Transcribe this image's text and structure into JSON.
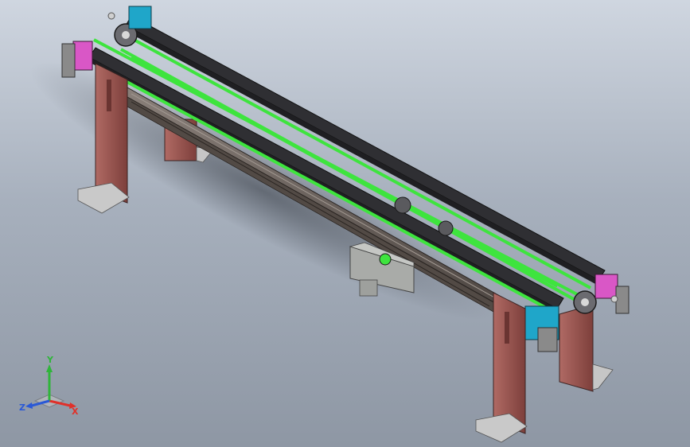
{
  "viewport": {
    "background_top": "#cfd6e0",
    "background_bottom": "#8e97a4"
  },
  "model": {
    "belt_color": "#3ee43e",
    "rail_color": "#2f2f33",
    "frame_color": "#6b625c",
    "leg_color": "#9c5a55",
    "bracket_pink": "#d957c6",
    "bracket_cyan": "#1fa6c9",
    "motor_color": "#a9aba8"
  },
  "triad": {
    "x_label": "X",
    "y_label": "Y",
    "z_label": "Z",
    "x_color": "#e0312a",
    "y_color": "#2fb53a",
    "z_color": "#2a59d6"
  }
}
